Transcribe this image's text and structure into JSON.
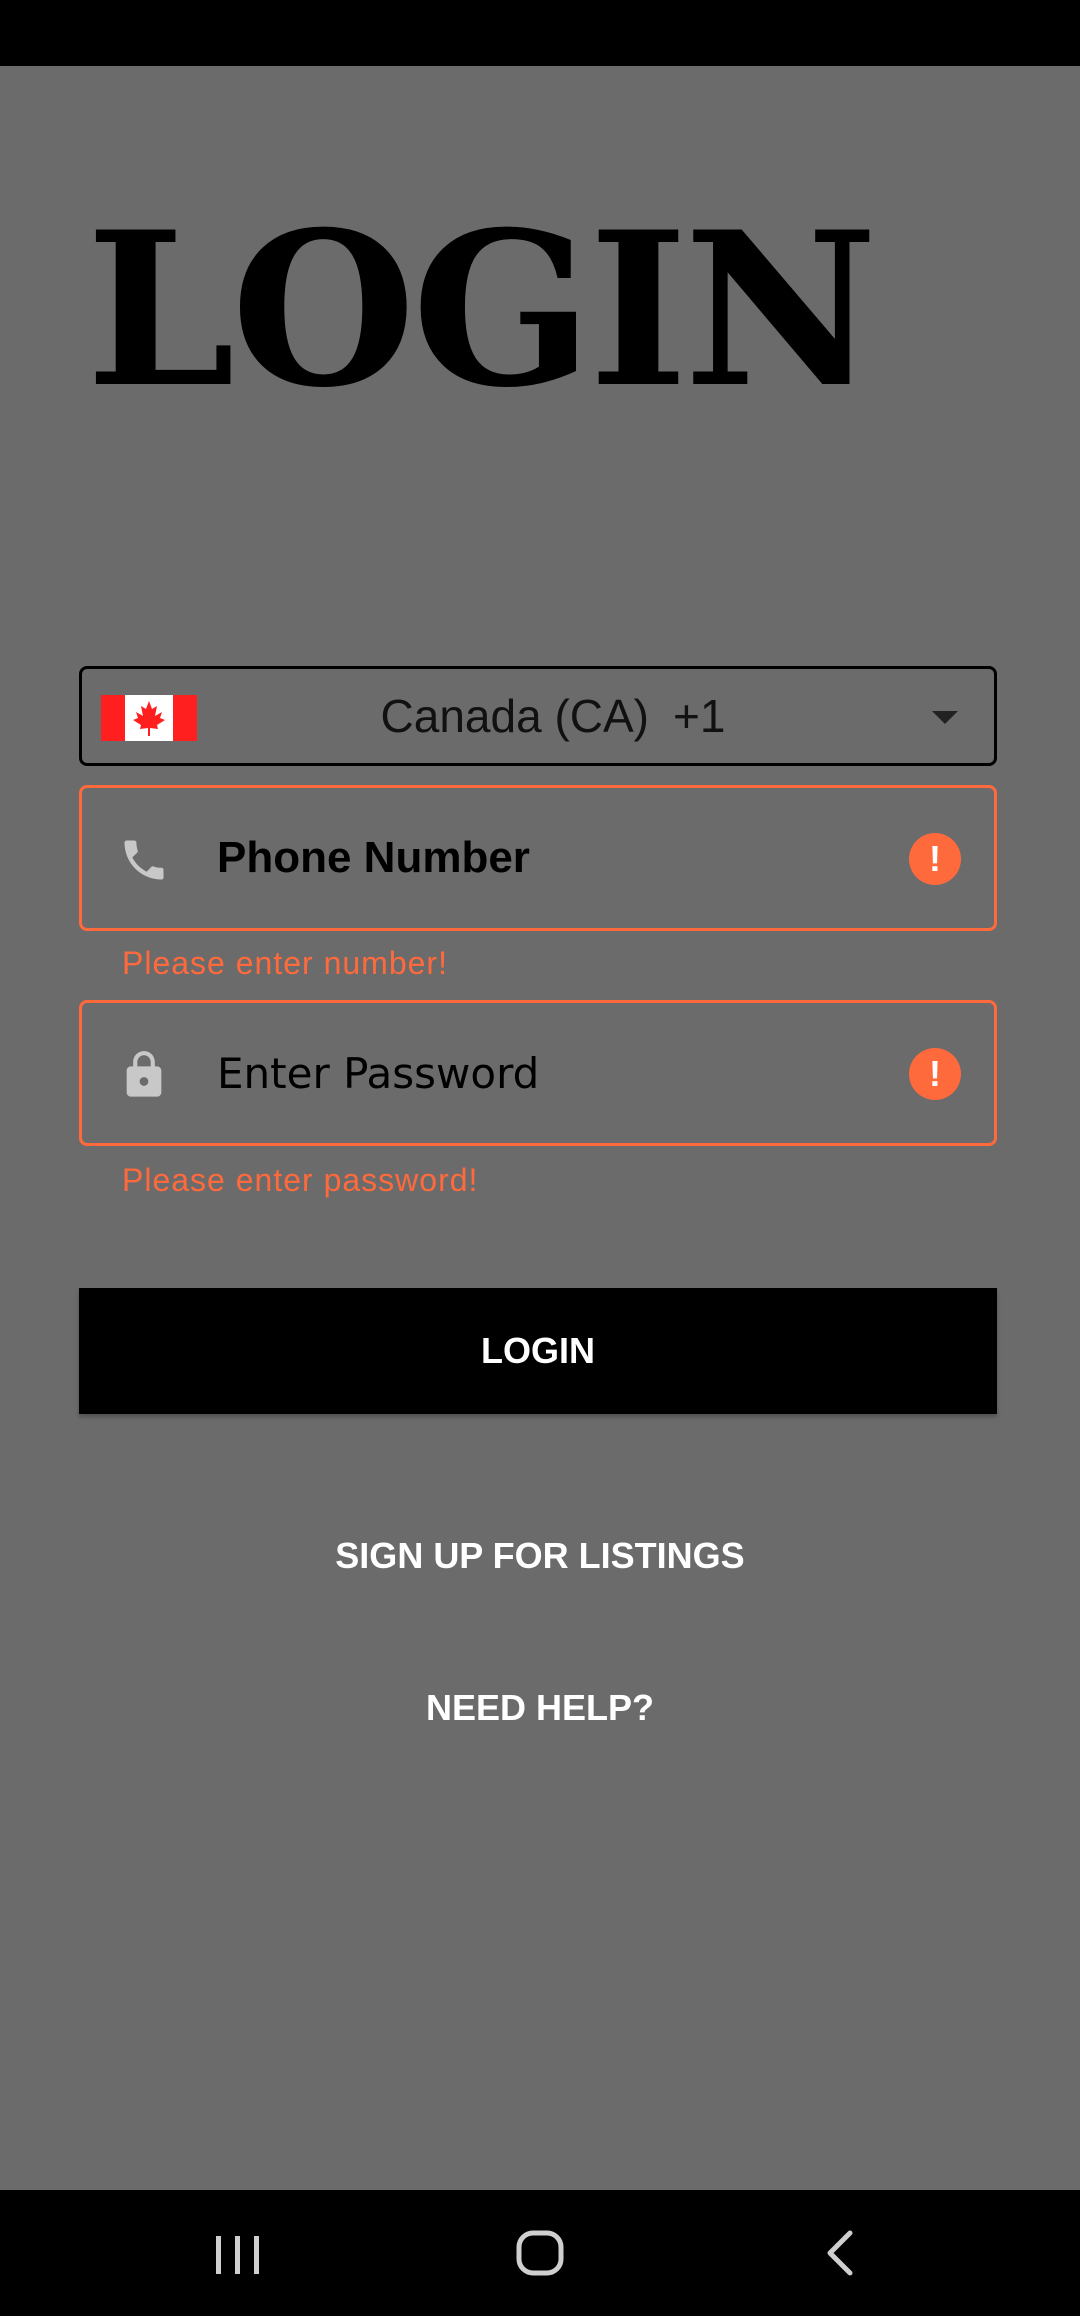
{
  "title": "LOGIN",
  "country_selector": {
    "country": "Canada (CA)",
    "dial_code": "+1",
    "flag_icon": "canada-flag-icon"
  },
  "phone_field": {
    "placeholder": "Phone Number",
    "value": "",
    "icon": "phone-icon",
    "error": "Please enter number!"
  },
  "password_field": {
    "placeholder": "Enter Password",
    "value": "",
    "icon": "lock-icon",
    "error": "Please enter password!"
  },
  "login_button": "LOGIN",
  "signup_link": "SIGN UP FOR LISTINGS",
  "help_link": "NEED HELP?",
  "colors": {
    "background": "#6b6b6b",
    "error": "#ff6a3d",
    "button": "#000000",
    "link_text": "#ffffff"
  },
  "nav_bar": {
    "icons": [
      "recents-icon",
      "home-icon",
      "back-icon"
    ]
  }
}
